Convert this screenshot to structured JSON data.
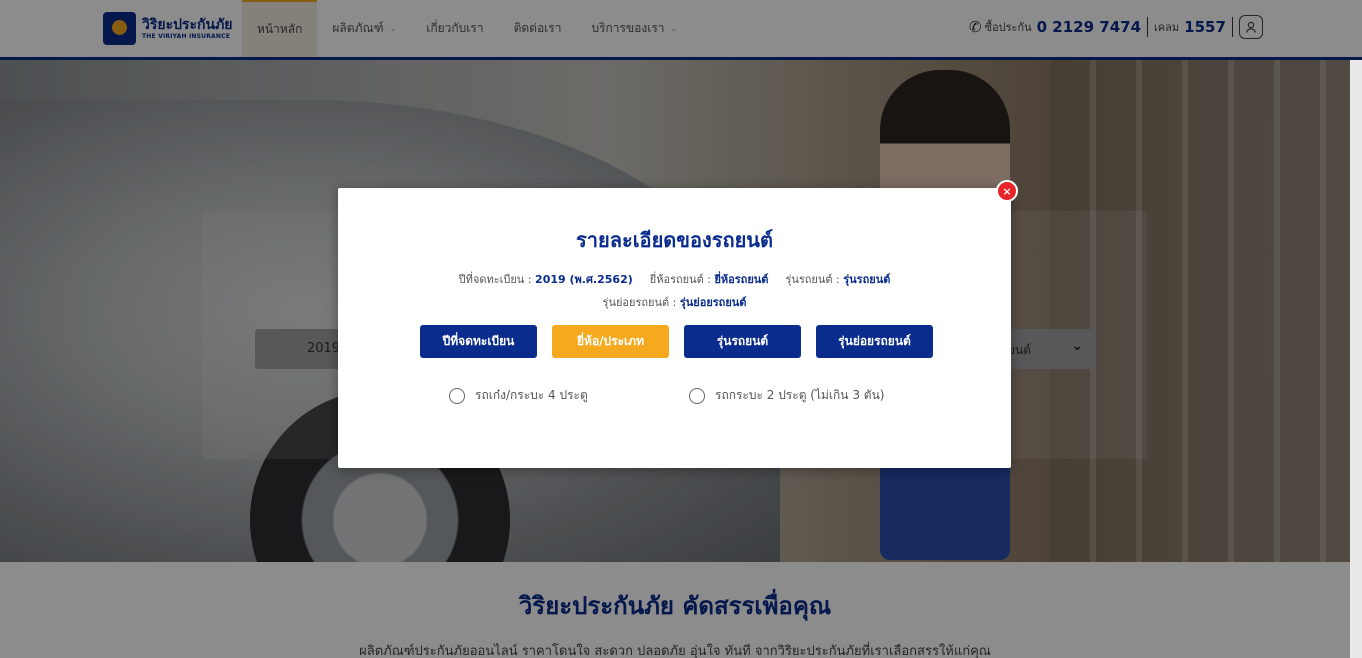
{
  "header": {
    "logo_th": "วิริยะประกันภัย",
    "logo_en": "THE VIRIYAH INSURANCE",
    "nav": [
      {
        "label": "หน้าหลัก",
        "active": true,
        "dropdown": false
      },
      {
        "label": "ผลิตภัณฑ์",
        "active": false,
        "dropdown": true
      },
      {
        "label": "เกี่ยวกับเรา",
        "active": false,
        "dropdown": false
      },
      {
        "label": "ติดต่อเรา",
        "active": false,
        "dropdown": false
      },
      {
        "label": "บริการของเรา",
        "active": false,
        "dropdown": true
      }
    ],
    "buy_label": "ซื้อประกัน",
    "buy_number": "0 2129 7474",
    "claim_label": "เคลม",
    "claim_number": "1557",
    "icons": {
      "phone": "phone-icon",
      "user": "user-icon"
    }
  },
  "hero": {
    "year_select_value": "2019",
    "model_select_value": "ยนต์"
  },
  "section": {
    "title": "วิริยะประกันภัย คัดสรรเพื่อคุณ",
    "subtitle": "ผลิตภัณฑ์ประกันภัยออนไลน์ ราคาโดนใจ สะดวก ปลอดภัย อุ่นใจ ทันที จากวิริยะประกันภัยที่เราเลือกสรรให้แก่คุณ"
  },
  "modal": {
    "close_label": "×",
    "title": "รายละเอียดของรถยนต์",
    "year_label": "ปีที่จดทะเบียน :",
    "year_value": "2019 (พ.ศ.2562)",
    "brand_label": "ยี่ห้อรถยนต์ :",
    "brand_value": "ยี่ห้อรถยนต์",
    "model_label": "รุ่นรถยนต์ :",
    "model_value": "รุ่นรถยนต์",
    "submodel_label": "รุ่นย่อยรถยนต์ :",
    "submodel_value": "รุ่นย่อยรถยนต์",
    "steps": [
      {
        "label": "ปีที่จดทะเบียน",
        "active": false
      },
      {
        "label": "ยี่ห้อ/ประเภท",
        "active": true
      },
      {
        "label": "รุ่นรถยนต์",
        "active": false
      },
      {
        "label": "รุ่นย่อยรถยนต์",
        "active": false
      }
    ],
    "options": [
      {
        "label": "รถเก๋ง/กระบะ 4 ประตู",
        "checked": false
      },
      {
        "label": "รถกระบะ 2 ประตู (ไม่เกิน 3 ตัน)",
        "checked": false
      }
    ]
  },
  "colors": {
    "brand_blue": "#0a2c8c",
    "accent_orange": "#f5a91f",
    "close_red": "#e8232a"
  }
}
